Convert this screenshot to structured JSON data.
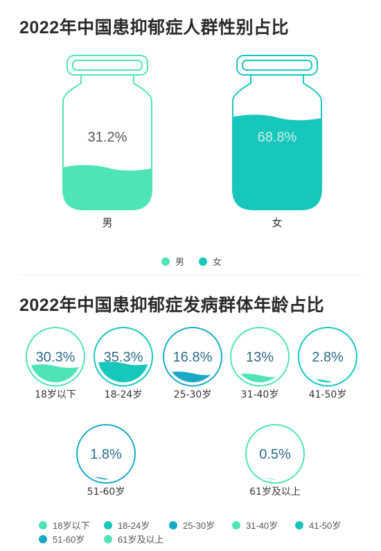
{
  "chart_data": [
    {
      "type": "pie",
      "title": "2022年中国患抑郁症人群性别占比",
      "categories": [
        "男",
        "女"
      ],
      "values": [
        31.2,
        68.8
      ],
      "value_labels": [
        "31.2%",
        "68.8%"
      ],
      "colors": [
        "#4fe3b8",
        "#17c7bb"
      ],
      "legend": {
        "position": "bottom"
      }
    },
    {
      "type": "pie",
      "title": "2022年中国患抑郁症发病群体年龄占比",
      "categories": [
        "18岁以下",
        "18-24岁",
        "25-30岁",
        "31-40岁",
        "41-50岁",
        "51-60岁",
        "61岁及以上"
      ],
      "values": [
        30.3,
        35.3,
        16.8,
        13,
        2.8,
        1.8,
        0.5
      ],
      "value_labels": [
        "30.3%",
        "35.3%",
        "16.8%",
        "13%",
        "2.8%",
        "1.8%",
        "0.5%"
      ],
      "colors": [
        "#4fe3b8",
        "#17c7bb",
        "#19a9c7",
        "#4fe3b8",
        "#17c7bb",
        "#19a9c7",
        "#4fe3b8"
      ],
      "legend": {
        "position": "bottom"
      }
    }
  ],
  "text_color": "#2c6a8a"
}
